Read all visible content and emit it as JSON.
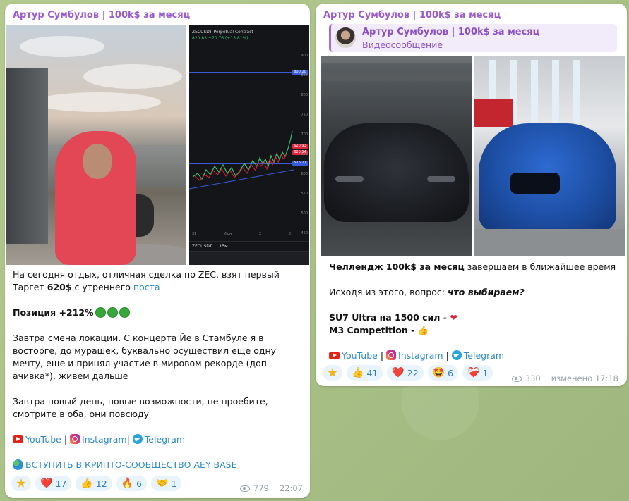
{
  "left_message": {
    "author": "Артур Сумбулов | 100k$ за месяц",
    "chart_screenshot": {
      "symbol_header": "ZECUSDT Perpetual Contract",
      "change": "820.83 +70.76 (+13,81%)",
      "symbol_footer": "ZECUSDT",
      "timeframe": "15м",
      "price_tags": [
        "800.20",
        "620.93",
        "620.54",
        "576.21"
      ],
      "axis_ticks": [
        "900",
        "850",
        "800",
        "750",
        "700",
        "650",
        "600",
        "550",
        "500",
        "450"
      ],
      "date_labels": [
        "31",
        "Июн",
        "2",
        "3"
      ]
    },
    "text": {
      "line1_a": "На сегодня отдых, отличная сделка по ZEC, взят первый Таргет",
      "line1_bold": "620$",
      "line1_b": " с утреннего ",
      "line1_link": "поста",
      "position_label": "Позиция +212%",
      "para2": "Завтра смена локации. С концерта Йе в Стамбуле я в восторге, до мурашек, буквально осуществил еще одну мечту, еще и принял участие в мировом рекорде (доп ачивка*), живем дальше",
      "para3": "Завтра новый день, новые возможности, не проебите, смотрите в оба, они повсюду",
      "youtube": "YouTube",
      "sep1": " | ",
      "instagram": "Instagram",
      "sep2": "| ",
      "telegram": "Telegram",
      "community_link": "ВСТУПИТЬ В КРИПТО-СООБЩЕСТВО AEY BASE"
    },
    "reactions": [
      {
        "emoji": "❤️",
        "count": "17",
        "icon": "heart-icon"
      },
      {
        "emoji": "👍",
        "count": "12",
        "icon": "thumbs-up-icon"
      },
      {
        "emoji": "🔥",
        "count": "6",
        "icon": "fire-icon"
      },
      {
        "emoji": "🤝",
        "count": "1",
        "icon": "handshake-icon"
      }
    ],
    "views": "779",
    "time": "22:07"
  },
  "right_message": {
    "author": "Артур Сумбулов | 100k$ за месяц",
    "reply": {
      "title": "Артур Сумбулов | 100k$ за месяц",
      "subtitle": "Видеосообщение"
    },
    "text": {
      "challenge_bold": "Челлендж 100k$ за месяц",
      "challenge_rest": " завершаем в ближайшее время",
      "question_a": "Исходя из этого, вопрос: ",
      "question_bold": "что выбираем?",
      "option1": "SU7 Ultra на 1500 сил - ",
      "option2": "M3 Competition - ",
      "youtube": "YouTube",
      "sep1": " | ",
      "instagram": "Instagram",
      "sep2": " | ",
      "telegram": "Telegram"
    },
    "reactions": [
      {
        "emoji": "👍",
        "count": "41",
        "icon": "thumbs-up-icon"
      },
      {
        "emoji": "❤️",
        "count": "22",
        "icon": "heart-icon"
      },
      {
        "emoji": "🤩",
        "count": "6",
        "icon": "star-struck-icon"
      },
      {
        "emoji": "❤️‍🩹",
        "count": "1",
        "icon": "mending-heart-icon"
      }
    ],
    "views": "330",
    "edited": "изменено 17:18"
  },
  "colors": {
    "author": "#9a5bd0",
    "link": "#2d8bc7",
    "reaction_bg": "#e8f3fb",
    "wallpaper": "#a9c18a"
  }
}
